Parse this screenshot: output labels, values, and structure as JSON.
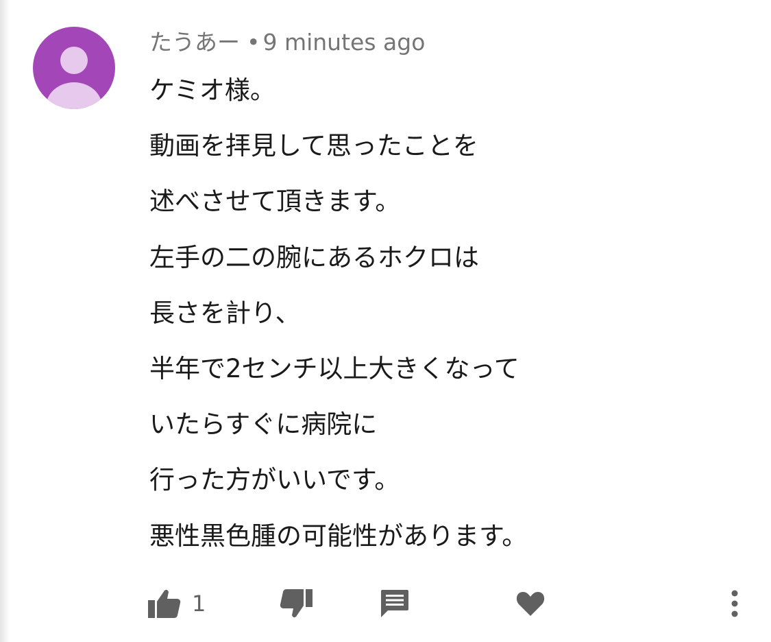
{
  "comment": {
    "author": "たうあー",
    "separator": "•",
    "time": "9 minutes ago",
    "lines": [
      "ケミオ様。",
      "動画を拝見して思ったことを",
      "述べさせて頂きます。",
      "左手の二の腕にあるホクロは",
      "長さを計り、",
      "半年で2センチ以上大きくなって",
      "いたらすぐに病院に",
      "行った方がいいです。",
      "悪性黒色腫の可能性があります。"
    ]
  },
  "actions": {
    "like_count": "1",
    "icons": [
      "thumb-up-icon",
      "thumb-down-icon",
      "reply-icon",
      "heart-icon",
      "more-vert-icon"
    ]
  },
  "colors": {
    "avatar_bg": "#a347b8",
    "avatar_fg": "#e6c9ec",
    "meta_text": "#757575",
    "body_text": "#1a1a1a",
    "icon": "#606060"
  }
}
